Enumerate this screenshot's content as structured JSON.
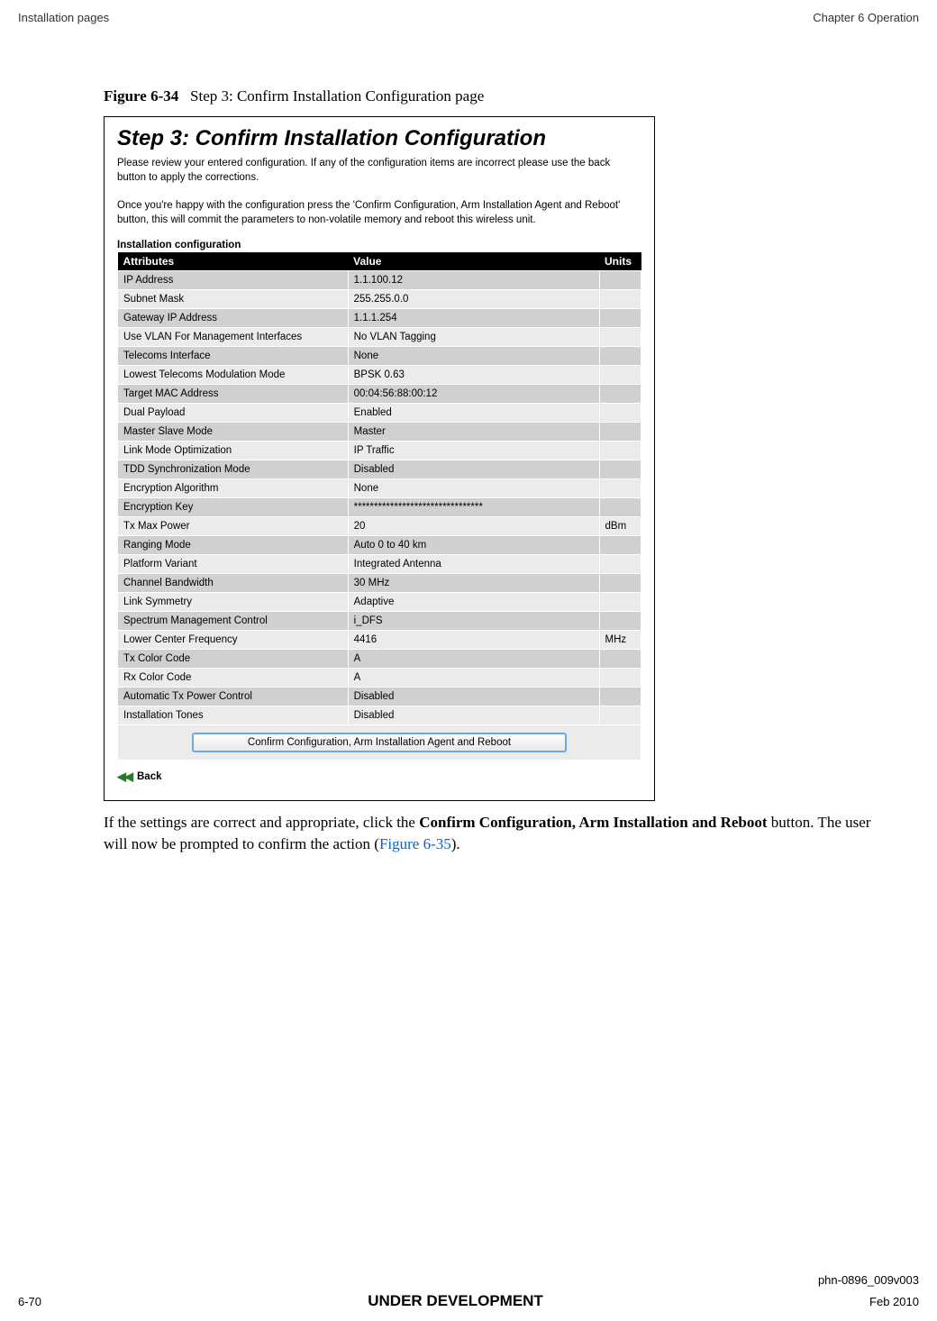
{
  "header": {
    "left": "Installation pages",
    "right": "Chapter 6 Operation"
  },
  "figure": {
    "label": "Figure 6-34",
    "caption": "Step 3: Confirm Installation Configuration page"
  },
  "screenshot": {
    "title": "Step 3: Confirm Installation Configuration",
    "desc1": "Please review your entered configuration. If any of the configuration items are incorrect please use the back button to apply the corrections.",
    "desc2": "Once you're happy with the configuration press the 'Confirm Configuration, Arm Installation Agent and Reboot' button, this will commit the parameters to non-volatile memory and reboot this wireless unit.",
    "tableLabel": "Installation configuration",
    "headers": {
      "attr": "Attributes",
      "value": "Value",
      "units": "Units"
    },
    "rows": [
      {
        "attr": "IP Address",
        "value": "1.1.100.12",
        "units": ""
      },
      {
        "attr": "Subnet Mask",
        "value": "255.255.0.0",
        "units": ""
      },
      {
        "attr": "Gateway IP Address",
        "value": "1.1.1.254",
        "units": ""
      },
      {
        "attr": "Use VLAN For Management Interfaces",
        "value": "No VLAN Tagging",
        "units": ""
      },
      {
        "attr": "Telecoms Interface",
        "value": "None",
        "units": ""
      },
      {
        "attr": "Lowest Telecoms Modulation Mode",
        "value": "BPSK 0.63",
        "units": ""
      },
      {
        "attr": "Target MAC Address",
        "value": "00:04:56:88:00:12",
        "units": ""
      },
      {
        "attr": "Dual Payload",
        "value": "Enabled",
        "units": ""
      },
      {
        "attr": "Master Slave Mode",
        "value": "Master",
        "units": ""
      },
      {
        "attr": "Link Mode Optimization",
        "value": "IP Traffic",
        "units": ""
      },
      {
        "attr": "TDD Synchronization Mode",
        "value": "Disabled",
        "units": ""
      },
      {
        "attr": "Encryption Algorithm",
        "value": "None",
        "units": ""
      },
      {
        "attr": "Encryption Key",
        "value": "********************************",
        "units": ""
      },
      {
        "attr": "Tx Max Power",
        "value": "20",
        "units": "dBm"
      },
      {
        "attr": "Ranging Mode",
        "value": "Auto 0 to 40 km",
        "units": ""
      },
      {
        "attr": "Platform Variant",
        "value": "Integrated Antenna",
        "units": ""
      },
      {
        "attr": "Channel Bandwidth",
        "value": "30 MHz",
        "units": ""
      },
      {
        "attr": "Link Symmetry",
        "value": "Adaptive",
        "units": ""
      },
      {
        "attr": "Spectrum Management Control",
        "value": "i_DFS",
        "units": ""
      },
      {
        "attr": "Lower Center Frequency",
        "value": "4416",
        "units": "MHz"
      },
      {
        "attr": "Tx Color Code",
        "value": "A",
        "units": ""
      },
      {
        "attr": "Rx Color Code",
        "value": "A",
        "units": ""
      },
      {
        "attr": "Automatic Tx Power Control",
        "value": "Disabled",
        "units": ""
      },
      {
        "attr": "Installation Tones",
        "value": "Disabled",
        "units": ""
      }
    ],
    "confirmButton": "Confirm Configuration, Arm Installation Agent and Reboot",
    "backLabel": "Back"
  },
  "bodyText": {
    "part1": "If the settings are correct and appropriate, click the ",
    "bold": "Confirm Configuration, Arm Installation and Reboot",
    "part2": " button. The user will now be prompted to confirm the action (",
    "link": "Figure 6-35",
    "part3": ")."
  },
  "footer": {
    "docId": "phn-0896_009v003",
    "pageNum": "6-70",
    "center": "UNDER DEVELOPMENT",
    "date": "Feb 2010"
  }
}
